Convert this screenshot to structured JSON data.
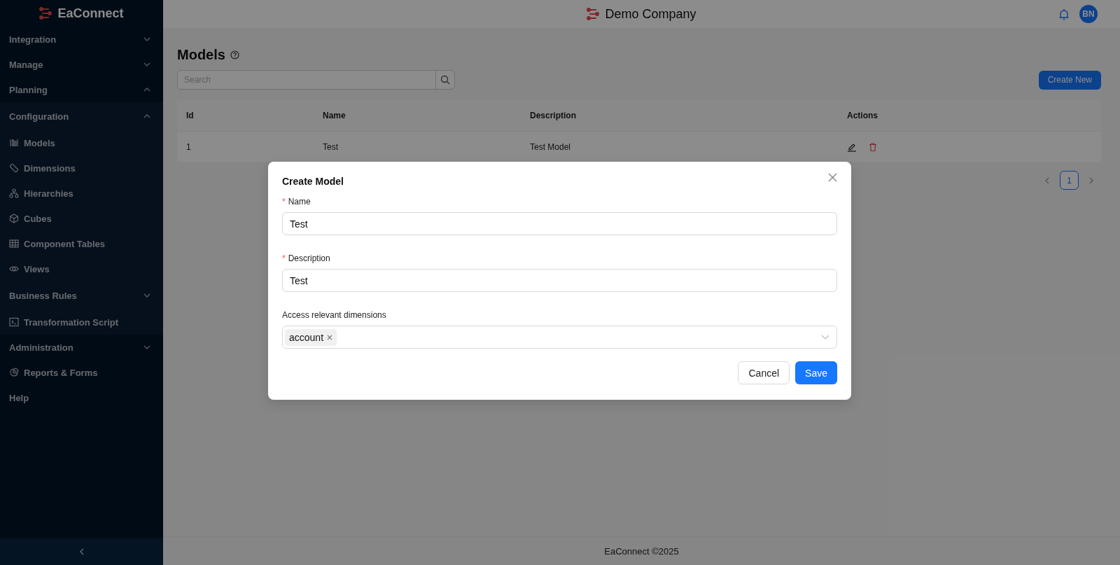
{
  "app": {
    "logo": "EaConnect",
    "company": "Demo Company",
    "avatar": "BN"
  },
  "sidebar": {
    "items": [
      {
        "kind": "group",
        "label": "Integration",
        "expanded": false
      },
      {
        "kind": "group",
        "label": "Manage",
        "expanded": false
      },
      {
        "kind": "group",
        "label": "Planning",
        "expanded": true,
        "children": [
          {
            "kind": "group",
            "label": "Configuration",
            "expanded": true,
            "children": [
              {
                "kind": "item",
                "label": "Models"
              },
              {
                "kind": "item",
                "label": "Dimensions"
              },
              {
                "kind": "item",
                "label": "Hierarchies"
              },
              {
                "kind": "item",
                "label": "Cubes"
              },
              {
                "kind": "item",
                "label": "Component Tables"
              },
              {
                "kind": "item",
                "label": "Views"
              }
            ]
          },
          {
            "kind": "group",
            "label": "Business Rules",
            "expanded": false
          },
          {
            "kind": "item",
            "label": "Transformation Script"
          }
        ]
      },
      {
        "kind": "group",
        "label": "Administration",
        "expanded": false
      },
      {
        "kind": "item",
        "label": "Reports & Forms"
      },
      {
        "kind": "item",
        "label": "Help"
      }
    ]
  },
  "page": {
    "title": "Models",
    "search": {
      "placeholder": "Search"
    },
    "create_button": "Create New",
    "table": {
      "columns": [
        "Id",
        "Name",
        "Description",
        "Actions"
      ],
      "rows": [
        {
          "cells": [
            "1",
            "Test",
            "Test Model"
          ]
        }
      ]
    },
    "pagination": {
      "pages": [
        {
          "label": "1",
          "selected": true
        }
      ]
    }
  },
  "footer": "EaConnect ©2025",
  "dialog": {
    "title": "Create Model",
    "fields": [
      {
        "kind": "text",
        "label": "Name",
        "required_mark": "*",
        "value": "Test"
      },
      {
        "kind": "text",
        "label": "Description",
        "required_mark": "*",
        "value": "Test"
      },
      {
        "kind": "tags",
        "label": "Access relevant dimensions",
        "tags": [
          "account"
        ]
      }
    ],
    "buttons": [
      {
        "label": "Cancel",
        "kind": "default"
      },
      {
        "label": "Save",
        "kind": "primary"
      }
    ]
  }
}
